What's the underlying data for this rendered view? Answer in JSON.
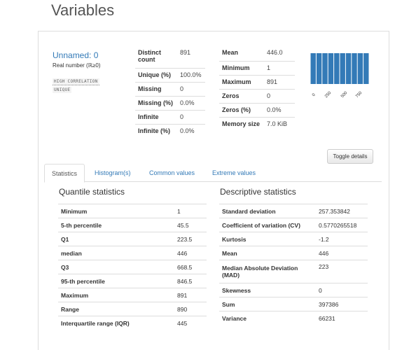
{
  "page": {
    "title": "Variables"
  },
  "variable": {
    "name": "Unnamed: 0",
    "type": "Real number (ℝ≥0)",
    "badges": [
      "HIGH CORRELATION",
      "UNIQUE"
    ]
  },
  "overview_left": [
    {
      "label": "Distinct count",
      "value": "891"
    },
    {
      "label": "Unique (%)",
      "value": "100.0%"
    },
    {
      "label": "Missing",
      "value": "0"
    },
    {
      "label": "Missing (%)",
      "value": "0.0%"
    },
    {
      "label": "Infinite",
      "value": "0"
    },
    {
      "label": "Infinite (%)",
      "value": "0.0%"
    }
  ],
  "overview_right": [
    {
      "label": "Mean",
      "value": "446.0"
    },
    {
      "label": "Minimum",
      "value": "1"
    },
    {
      "label": "Maximum",
      "value": "891"
    },
    {
      "label": "Zeros",
      "value": "0"
    },
    {
      "label": "Zeros (%)",
      "value": "0.0%"
    },
    {
      "label": "Memory size",
      "value": "7.0 KiB"
    }
  ],
  "mini_histogram": {
    "color": "#337ab7",
    "bins": [
      1,
      1,
      1,
      1,
      1,
      1,
      1,
      1,
      1,
      1
    ],
    "ticks": [
      "0",
      "250",
      "500",
      "750"
    ]
  },
  "toggle_label": "Toggle details",
  "tabs": [
    "Statistics",
    "Histogram(s)",
    "Common values",
    "Extreme values"
  ],
  "quantile": {
    "title": "Quantile statistics",
    "rows": [
      {
        "label": "Minimum",
        "value": "1"
      },
      {
        "label": "5-th percentile",
        "value": "45.5"
      },
      {
        "label": "Q1",
        "value": "223.5"
      },
      {
        "label": "median",
        "value": "446"
      },
      {
        "label": "Q3",
        "value": "668.5"
      },
      {
        "label": "95-th percentile",
        "value": "846.5"
      },
      {
        "label": "Maximum",
        "value": "891"
      },
      {
        "label": "Range",
        "value": "890"
      },
      {
        "label": "Interquartile range (IQR)",
        "value": "445"
      }
    ]
  },
  "descriptive": {
    "title": "Descriptive statistics",
    "rows": [
      {
        "label": "Standard deviation",
        "value": "257.353842"
      },
      {
        "label": "Coefficient of variation (CV)",
        "value": "0.5770265518"
      },
      {
        "label": "Kurtosis",
        "value": "-1.2"
      },
      {
        "label": "Mean",
        "value": "446"
      },
      {
        "label": "Median Absolute Deviation (MAD)",
        "value": "223"
      },
      {
        "label": "Skewness",
        "value": "0"
      },
      {
        "label": "Sum",
        "value": "397386"
      },
      {
        "label": "Variance",
        "value": "66231"
      }
    ]
  }
}
